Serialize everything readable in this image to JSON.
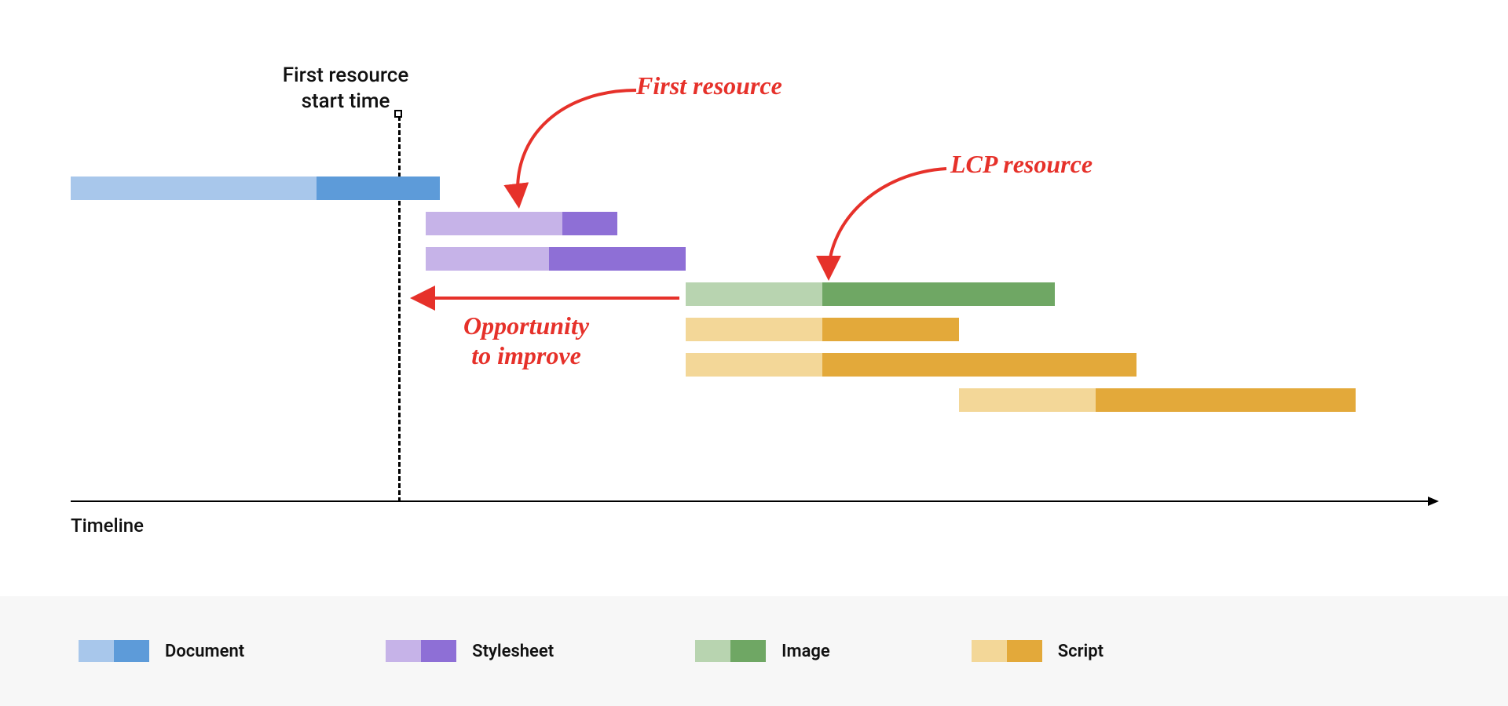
{
  "chart_data": {
    "type": "gantt",
    "xlabel": "Timeline",
    "marker": {
      "x": 24,
      "label": "First resource\nstart time"
    },
    "bars": [
      {
        "name": "document",
        "category": "Document",
        "start": 0,
        "split": 18,
        "end": 27
      },
      {
        "name": "stylesheet1",
        "category": "Stylesheet",
        "start": 26,
        "split": 36,
        "end": 40
      },
      {
        "name": "stylesheet2",
        "category": "Stylesheet",
        "start": 26,
        "split": 35,
        "end": 45
      },
      {
        "name": "image",
        "category": "Image",
        "start": 45,
        "split": 55,
        "end": 72
      },
      {
        "name": "script1",
        "category": "Script",
        "start": 45,
        "split": 55,
        "end": 65
      },
      {
        "name": "script2",
        "category": "Script",
        "start": 45,
        "split": 55,
        "end": 78
      },
      {
        "name": "script3",
        "category": "Script",
        "start": 65,
        "split": 75,
        "end": 94
      }
    ],
    "annotations": [
      {
        "id": "first-resource",
        "text": "First resource",
        "points_to": "stylesheet1"
      },
      {
        "id": "lcp-resource",
        "text": "LCP resource",
        "points_to": "image"
      },
      {
        "id": "opportunity",
        "text": "Opportunity\nto improve",
        "span": [
          "marker",
          "image.start"
        ]
      }
    ],
    "legend": [
      {
        "label": "Document",
        "light": "#a8c7eb",
        "dark": "#5d9bd9"
      },
      {
        "label": "Stylesheet",
        "light": "#c6b3e8",
        "dark": "#8e6fd6"
      },
      {
        "label": "Image",
        "light": "#b8d4b0",
        "dark": "#6fa764"
      },
      {
        "label": "Script",
        "light": "#f3d798",
        "dark": "#e3a93a"
      }
    ],
    "colors": {
      "Document": {
        "light": "#a8c7eb",
        "dark": "#5d9bd9"
      },
      "Stylesheet": {
        "light": "#c6b3e8",
        "dark": "#8e6fd6"
      },
      "Image": {
        "light": "#b8d4b0",
        "dark": "#6fa764"
      },
      "Script": {
        "light": "#f3d798",
        "dark": "#e3a93a"
      }
    }
  }
}
